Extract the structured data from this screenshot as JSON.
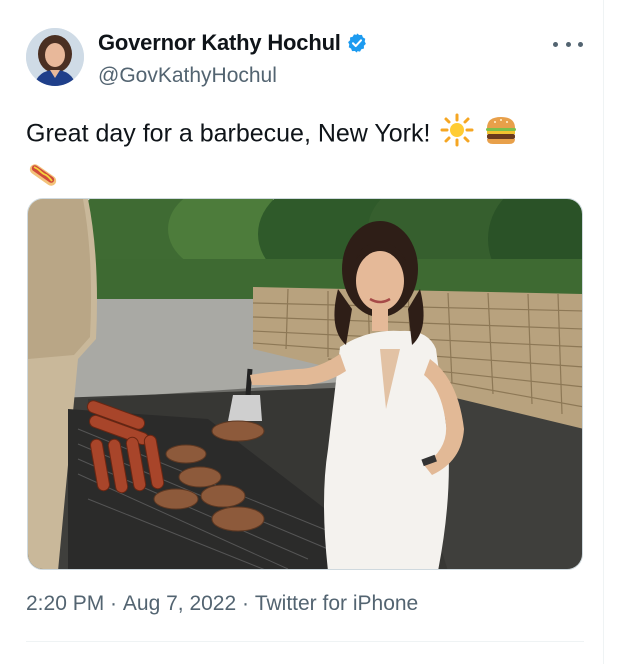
{
  "author": {
    "display_name": "Governor Kathy Hochul",
    "handle": "@GovKathyHochul",
    "verified_color": "#1d9bf0"
  },
  "tweet": {
    "text": "Great day for a barbecue, New York!",
    "emojis": [
      "sun-emoji",
      "hamburger-emoji",
      "hotdog-emoji"
    ]
  },
  "meta": {
    "time": "2:20 PM",
    "separator": " · ",
    "date": "Aug 7, 2022",
    "source": "Twitter for iPhone"
  },
  "icons": {
    "more": "more-dots-icon",
    "verified": "verified-badge-icon"
  },
  "colors": {
    "text_primary": "#0f1419",
    "text_secondary": "#536471",
    "accent": "#1d9bf0"
  }
}
